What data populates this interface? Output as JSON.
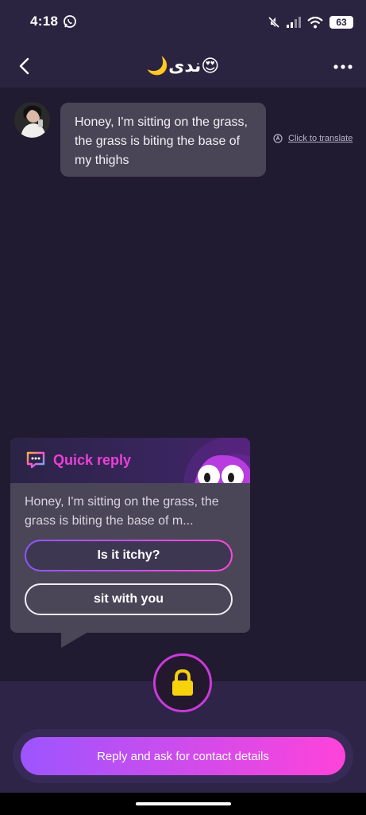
{
  "status_bar": {
    "time": "4:18",
    "battery": "63"
  },
  "header": {
    "title": "🌙ندى😍"
  },
  "chat": {
    "messages": [
      {
        "text": "Honey, I'm sitting on the grass, the grass is biting the base of my thighs",
        "translate_label": "Click to translate"
      }
    ]
  },
  "quick_reply": {
    "title": "Quick reply",
    "preview": "Honey, I'm sitting on the grass, the grass is biting the base of m...",
    "options": [
      {
        "label": "Is it itchy?"
      },
      {
        "label": "sit with you"
      }
    ]
  },
  "bottom": {
    "cta_label": "Reply and ask for contact details"
  },
  "colors": {
    "background": "#211b31",
    "accent_purple": "#9d55ff",
    "accent_pink": "#ff43d9",
    "quick_reply_title": "#ec3fd6",
    "lock": "#f5d20b"
  }
}
